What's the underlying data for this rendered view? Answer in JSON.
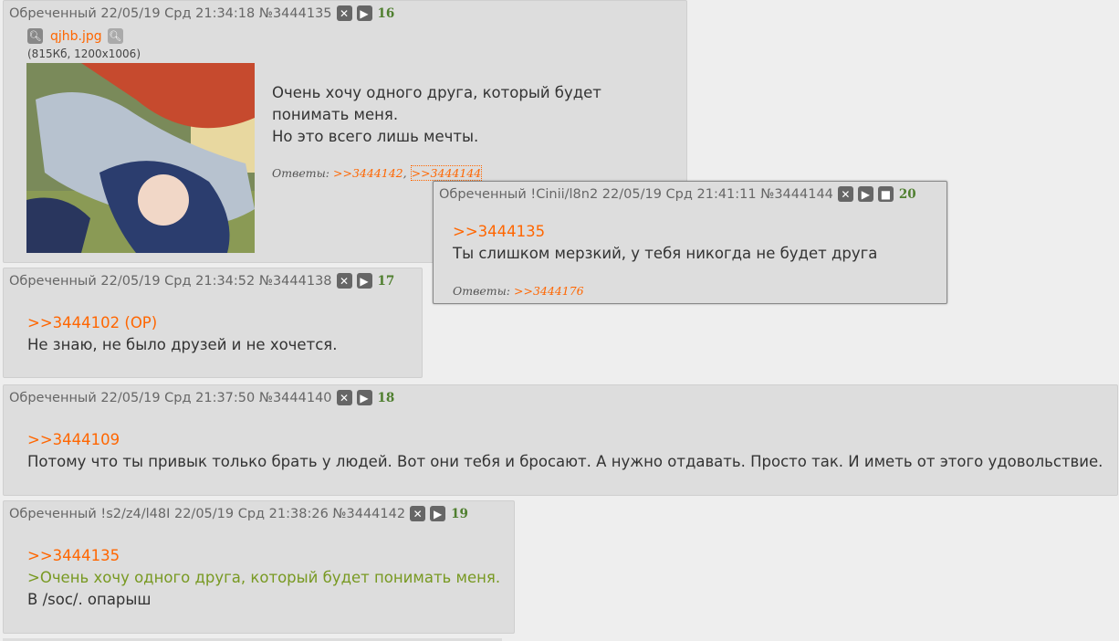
{
  "posts": [
    {
      "author": "Обреченный",
      "date": "22/05/19 Срд 21:34:18",
      "id": "№3444135",
      "num": "16",
      "file": {
        "name": "qjhb.jpg",
        "info": "(815Кб, 1200x1006)"
      },
      "lines": [
        "Очень хочу одного друга, который будет",
        "понимать меня.",
        "Но это всего лишь мечты."
      ],
      "replies_label": "Ответы:",
      "replies": [
        ">>3444142",
        ">>3444144"
      ]
    },
    {
      "author": "Обреченный",
      "date": "22/05/19 Срд 21:34:52",
      "id": "№3444138",
      "num": "17",
      "link": ">>3444102 (OP)",
      "lines": [
        "Не знаю, не было друзей и не хочется."
      ]
    },
    {
      "author": "Обреченный",
      "date": "22/05/19 Срд 21:37:50",
      "id": "№3444140",
      "num": "18",
      "link": ">>3444109",
      "lines": [
        "Потому что ты привык только брать у людей. Вот они тебя и бросают. А нужно отдавать. Просто так. И иметь от этого удовольствие."
      ]
    },
    {
      "author": "Обреченный !s2/z4/l48I",
      "date": "22/05/19 Срд 21:38:26",
      "id": "№3444142",
      "num": "19",
      "link": ">>3444135",
      "quote": ">Очень хочу одного друга, который будет понимать меня.",
      "lines": [
        "В /soc/. опарыш"
      ]
    }
  ],
  "popup": {
    "author": "Обреченный !Cinii/l8n2",
    "date": "22/05/19 Срд 21:41:11",
    "id": "№3444144",
    "num": "20",
    "link": ">>3444135",
    "lines": [
      "Ты слишком мерзкий, у тебя никогда не будет друга"
    ],
    "replies_label": "Ответы:",
    "replies": [
      ">>3444176"
    ]
  },
  "icons": {
    "hide": "close-x-icon",
    "play": "play-icon",
    "stop": "stop-icon",
    "search": "magnifier-icon"
  },
  "colors": {
    "link": "#ff6600",
    "quote": "#789922",
    "postnum": "#4f7f2f",
    "post_bg": "#dddddd",
    "page_bg": "#eeeeee"
  }
}
